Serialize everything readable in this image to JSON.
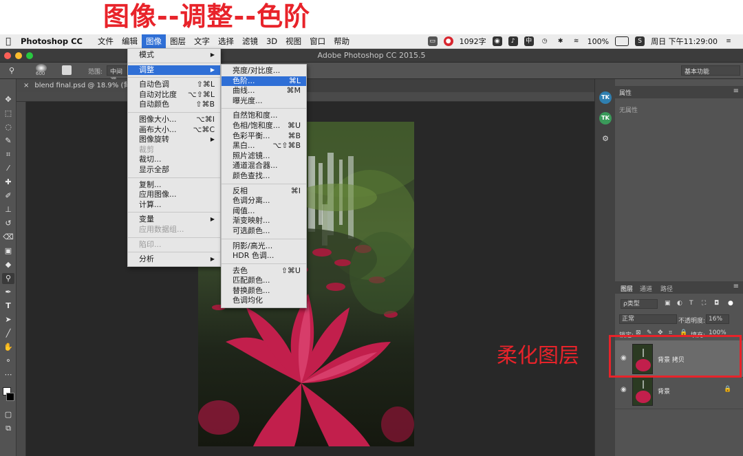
{
  "annotations": {
    "title": "图像--调整--色阶",
    "layer_note": "柔化图层"
  },
  "macbar": {
    "app_name": "Photoshop CC",
    "menus": [
      "文件",
      "编辑",
      "图像",
      "图层",
      "文字",
      "选择",
      "滤镜",
      "3D",
      "视图",
      "窗口",
      "帮助"
    ],
    "active_menu": "图像",
    "word_count": "1092字",
    "battery": "100%",
    "clock": "周日 下午11:29:00"
  },
  "window": {
    "title": "Adobe Photoshop CC 2015.5"
  },
  "options_bar": {
    "brush_size": "600",
    "range_label": "范围:",
    "range_value": "中间调",
    "workspace": "基本功能"
  },
  "document": {
    "tab_title": "blend final.psd @ 18.9% (背景 拷"
  },
  "image_menu": {
    "items": [
      {
        "label": "模式",
        "arrow": "▶"
      },
      {
        "sep": true
      },
      {
        "label": "调整",
        "arrow": "▶",
        "highlight": true
      },
      {
        "sep": true
      },
      {
        "label": "自动色调",
        "shortcut": "⇧⌘L"
      },
      {
        "label": "自动对比度",
        "shortcut": "⌥⇧⌘L"
      },
      {
        "label": "自动颜色",
        "shortcut": "⇧⌘B"
      },
      {
        "sep": true
      },
      {
        "label": "图像大小...",
        "shortcut": "⌥⌘I"
      },
      {
        "label": "画布大小...",
        "shortcut": "⌥⌘C"
      },
      {
        "label": "图像旋转",
        "arrow": "▶"
      },
      {
        "label": "裁剪",
        "disabled": true
      },
      {
        "label": "裁切..."
      },
      {
        "label": "显示全部"
      },
      {
        "sep": true
      },
      {
        "label": "复制..."
      },
      {
        "label": "应用图像..."
      },
      {
        "label": "计算..."
      },
      {
        "sep": true
      },
      {
        "label": "变量",
        "arrow": "▶"
      },
      {
        "label": "应用数据组...",
        "disabled": true
      },
      {
        "sep": true
      },
      {
        "label": "陷印...",
        "disabled": true
      },
      {
        "sep": true
      },
      {
        "label": "分析",
        "arrow": "▶"
      }
    ]
  },
  "adjust_menu": {
    "items": [
      {
        "label": "亮度/对比度..."
      },
      {
        "label": "色阶...",
        "shortcut": "⌘L",
        "highlight": true
      },
      {
        "label": "曲线...",
        "shortcut": "⌘M"
      },
      {
        "label": "曝光度..."
      },
      {
        "sep": true
      },
      {
        "label": "自然饱和度..."
      },
      {
        "label": "色相/饱和度...",
        "shortcut": "⌘U"
      },
      {
        "label": "色彩平衡...",
        "shortcut": "⌘B"
      },
      {
        "label": "黑白...",
        "shortcut": "⌥⇧⌘B"
      },
      {
        "label": "照片滤镜..."
      },
      {
        "label": "通道混合器..."
      },
      {
        "label": "颜色查找..."
      },
      {
        "sep": true
      },
      {
        "label": "反相",
        "shortcut": "⌘I"
      },
      {
        "label": "色调分离..."
      },
      {
        "label": "阈值..."
      },
      {
        "label": "渐变映射..."
      },
      {
        "label": "可选颜色..."
      },
      {
        "sep": true
      },
      {
        "label": "阴影/高光..."
      },
      {
        "label": "HDR 色调..."
      },
      {
        "sep": true
      },
      {
        "label": "去色",
        "shortcut": "⇧⌘U"
      },
      {
        "label": "匹配颜色..."
      },
      {
        "label": "替换颜色..."
      },
      {
        "label": "色调均化"
      }
    ]
  },
  "properties_panel": {
    "tab": "属性",
    "empty_text": "无属性"
  },
  "layers_panel": {
    "tabs": [
      "图层",
      "通道",
      "路径"
    ],
    "filter_label": "ρ类型",
    "blend_mode": "正常",
    "opacity_label": "不透明度:",
    "opacity_value": "16%",
    "lock_label": "锁定:",
    "fill_label": "填充:",
    "fill_value": "100%",
    "layers": [
      {
        "name": "背景 拷贝",
        "selected": true
      },
      {
        "name": "背景",
        "locked": true
      }
    ]
  },
  "colors": {
    "menu_highlight": "#2f6fd6",
    "annotation_red": "#e8232a",
    "ps_panel": "#535353"
  }
}
